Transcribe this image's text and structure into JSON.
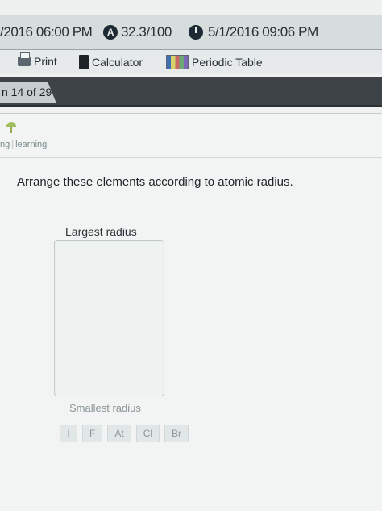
{
  "status_bar": {
    "due": "/2016 06:00 PM",
    "score_icon": "score-icon",
    "score": "32.3/100",
    "clock_icon": "clock-icon",
    "date": "5/1/2016 09:06 PM"
  },
  "toolbar": {
    "print_label": "Print",
    "calculator_label": "Calculator",
    "periodic_table_label": "Periodic Table"
  },
  "question_tab": {
    "label": "n 14 of 29"
  },
  "brand": {
    "left": "ng",
    "right": "learning"
  },
  "question": {
    "prompt": "Arrange these elements according to atomic radius.",
    "top_label": "Largest radius",
    "bottom_label": "Smallest radius",
    "tiles": [
      "I",
      "F",
      "At",
      "Cl",
      "Br"
    ]
  }
}
